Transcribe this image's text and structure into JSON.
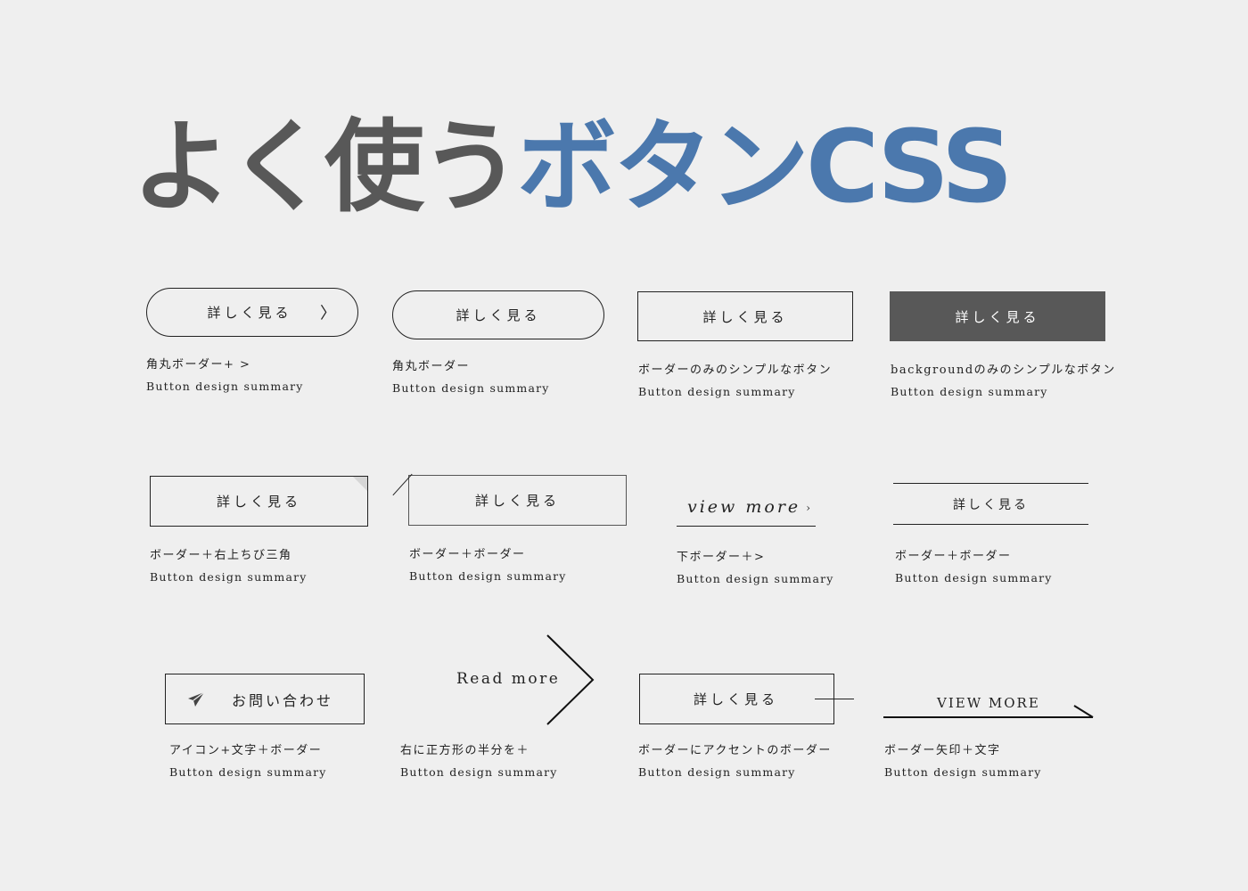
{
  "title": {
    "part1": "よく使う",
    "part2": "ボタンCSS"
  },
  "colors": {
    "background": "#efefef",
    "title_dark": "#585858",
    "title_accent": "#4b78ad",
    "button_fill": "#585858"
  },
  "buttons": [
    {
      "label": "詳しく見る",
      "icon": "chevron-right-icon",
      "icon_glyph": "〉",
      "caption_jp": "角丸ボーダー+ >",
      "caption_en": "Button design summary"
    },
    {
      "label": "詳しく見る",
      "caption_jp": "角丸ボーダー",
      "caption_en": "Button design summary"
    },
    {
      "label": "詳しく見る",
      "caption_jp": "ボーダーのみのシンプルなボタン",
      "caption_en": "Button design summary"
    },
    {
      "label": "詳しく見る",
      "caption_jp": "backgroundのみのシンプルなボタン",
      "caption_en": "Button design summary"
    },
    {
      "label": "詳しく見る",
      "caption_jp": "ボーダー＋右上ちび三角",
      "caption_en": "Button design summary"
    },
    {
      "label": "詳しく見る",
      "caption_jp": "ボーダー＋ボーダー",
      "caption_en": "Button design summary"
    },
    {
      "label": "view more",
      "icon": "chevron-right-icon",
      "icon_glyph": "›",
      "caption_jp": "下ボーダー＋>",
      "caption_en": "Button design summary"
    },
    {
      "label": "詳しく見る",
      "caption_jp": "ボーダー＋ボーダー",
      "caption_en": "Button design summary"
    },
    {
      "label": "お問い合わせ",
      "icon": "paper-plane-icon",
      "caption_jp": "アイコン+文字＋ボーダー",
      "caption_en": "Button design summary"
    },
    {
      "label": "Read more",
      "icon": "large-chevron-icon",
      "caption_jp": "右に正方形の半分を＋",
      "caption_en": "Button design summary"
    },
    {
      "label": "詳しく見る",
      "caption_jp": "ボーダーにアクセントのボーダー",
      "caption_en": "Button design summary"
    },
    {
      "label": "VIEW MORE",
      "icon": "arrow-line-icon",
      "caption_jp": "ボーダー矢印＋文字",
      "caption_en": "Button design summary"
    }
  ]
}
